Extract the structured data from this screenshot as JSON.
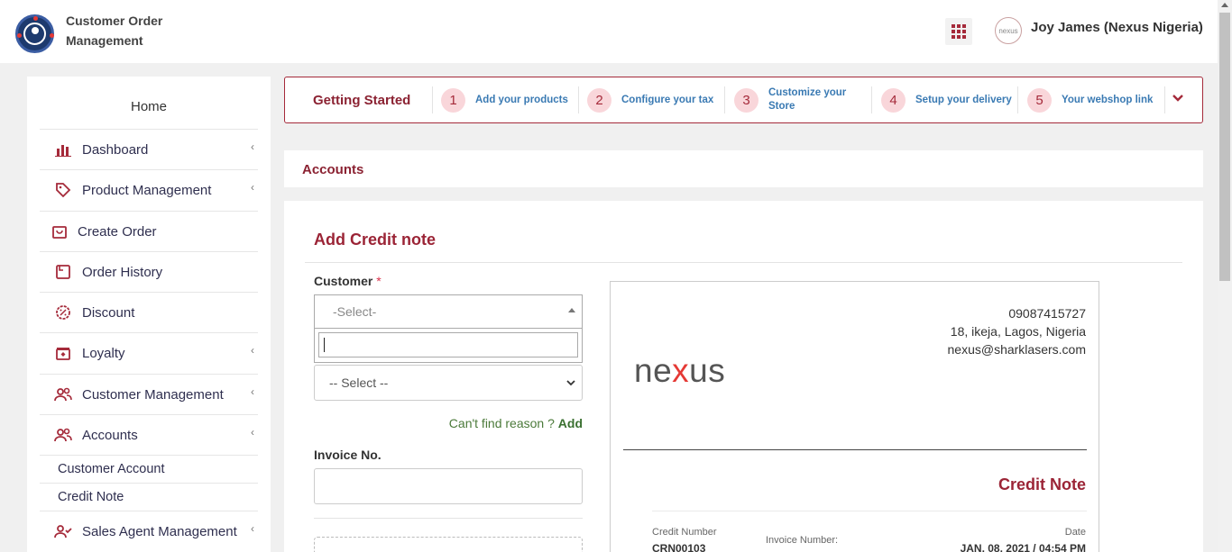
{
  "header": {
    "app_title": "Customer Order Management",
    "avatar_text": "nexus",
    "user_name": "Joy James (Nexus Nigeria)"
  },
  "sidebar": {
    "home": "Home",
    "items": [
      {
        "label": "Dashboard",
        "icon": "bar-chart-icon"
      },
      {
        "label": "Product Management",
        "icon": "tag-icon"
      },
      {
        "label": "Create Order",
        "icon": "cart-icon"
      },
      {
        "label": "Order History",
        "icon": "history-icon"
      },
      {
        "label": "Discount",
        "icon": "discount-icon"
      },
      {
        "label": "Loyalty",
        "icon": "gift-icon"
      },
      {
        "label": "Customer Management",
        "icon": "users-icon"
      },
      {
        "label": "Accounts",
        "icon": "users-icon"
      },
      {
        "label": "Sales Agent Management",
        "icon": "user-check-icon"
      }
    ],
    "sub_items": [
      "Customer Account",
      "Credit Note"
    ]
  },
  "getting_started": {
    "title": "Getting Started",
    "steps": [
      {
        "num": "1",
        "label": "Add your products"
      },
      {
        "num": "2",
        "label": "Configure your tax"
      },
      {
        "num": "3",
        "label": "Customize your Store"
      },
      {
        "num": "4",
        "label": "Setup your delivery"
      },
      {
        "num": "5",
        "label": "Your webshop link"
      }
    ]
  },
  "page": {
    "section": "Accounts",
    "card_title": "Add Credit note"
  },
  "form": {
    "customer_label": "Customer",
    "required_mark": "*",
    "customer_placeholder": "-Select-",
    "reason_placeholder": "-- Select --",
    "cant_find": "Can't find reason ?",
    "add_link": "Add",
    "invoice_label": "Invoice No."
  },
  "preview": {
    "brand_pre": "ne",
    "brand_x": "x",
    "brand_post": "us",
    "phone": "09087415727",
    "address": "18, ikeja, Lagos, Nigeria",
    "email": "nexus@sharklasers.com",
    "title": "Credit Note",
    "credit_number_label": "Credit Number",
    "credit_number": "CRN00103",
    "invoice_number_label": "Invoice Number:",
    "date_label": "Date",
    "date": "JAN, 08, 2021 / 04:54 PM"
  },
  "colors": {
    "brand": "#9b2436",
    "link": "#3a7ab3"
  }
}
